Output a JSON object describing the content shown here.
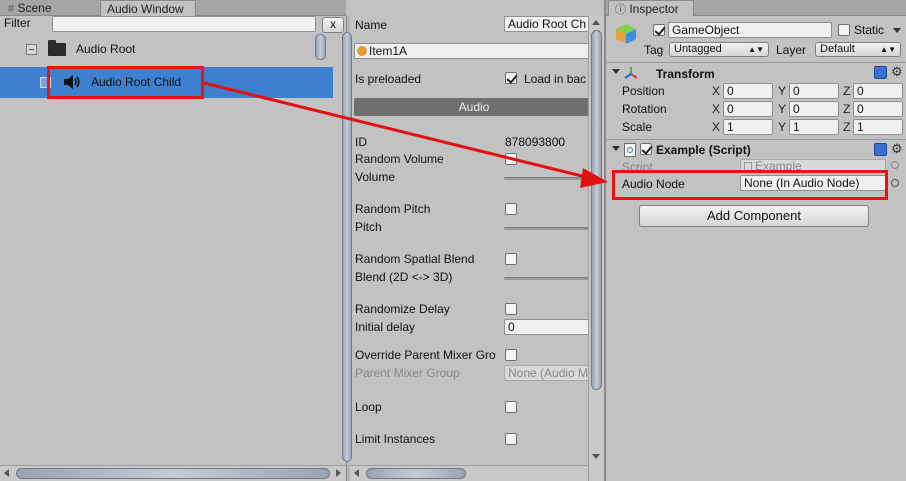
{
  "tabs": {
    "scene": "Scene",
    "audio_window": "Audio Window",
    "inspector": "Inspector"
  },
  "tree": {
    "filter_label": "Filter",
    "filter_value": "",
    "clear_label": "x",
    "root_label": "Audio Root",
    "child_label": "Audio Root Child"
  },
  "props": {
    "name_label": "Name",
    "name_value": "Audio Root Ch",
    "item_value": "Item1A",
    "preloaded_label": "Is preloaded",
    "load_label": "Load in bac",
    "audio_header": "Audio",
    "id_label": "ID",
    "id_value": "878093800",
    "random_volume_label": "Random Volume",
    "volume_label": "Volume",
    "random_pitch_label": "Random Pitch",
    "pitch_label": "Pitch",
    "random_spatial_label": "Random Spatial Blend",
    "blend_label": "Blend (2D <-> 3D)",
    "randomize_delay_label": "Randomize Delay",
    "initial_delay_label": "Initial delay",
    "initial_delay_value": "0",
    "override_mixer_label": "Override Parent Mixer Gro",
    "parent_mixer_label": "Parent Mixer Group",
    "parent_mixer_value": "None (Audio M",
    "loop_label": "Loop",
    "limit_label": "Limit Instances"
  },
  "inspector": {
    "gameobject_name": "GameObject",
    "static_label": "Static",
    "tag_label": "Tag",
    "tag_value": "Untagged",
    "layer_label": "Layer",
    "layer_value": "Default",
    "transform_title": "Transform",
    "position_label": "Position",
    "rotation_label": "Rotation",
    "scale_label": "Scale",
    "axis_x": "X",
    "axis_y": "Y",
    "axis_z": "Z",
    "position": [
      "0",
      "0",
      "0"
    ],
    "rotation": [
      "0",
      "0",
      "0"
    ],
    "scale": [
      "1",
      "1",
      "1"
    ],
    "script_title": "Example (Script)",
    "script_label": "Script",
    "script_value": "Example",
    "audio_node_label": "Audio Node",
    "audio_node_value": "None (In Audio Node)",
    "add_component_label": "Add Component"
  },
  "colors": {
    "selection": "#3e7fd0",
    "highlight": "#e11111",
    "panel": "#c2c2c2"
  }
}
